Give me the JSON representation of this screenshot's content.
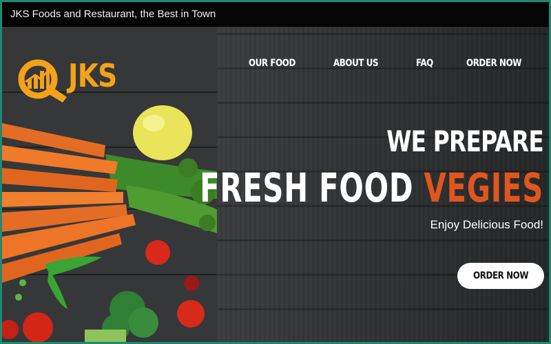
{
  "page": {
    "title": "JKS Foods and Restaurant, the Best in Town"
  },
  "brand": {
    "logo_text": "JKS",
    "logo_color": "#f4a21a"
  },
  "nav": {
    "items": [
      "OUR FOOD",
      "ABOUT US",
      "FAQ",
      "ORDER NOW"
    ]
  },
  "hero": {
    "line1": "WE PREPARE",
    "line2_main": "FRESH FOOD",
    "line2_accent": "VEGIES",
    "accent_color": "#e0561f",
    "tagline": "Enjoy Delicious Food!",
    "cta_label": "ORDER NOW"
  },
  "icons": {
    "logo": "chart-magnifier-logo-icon"
  }
}
